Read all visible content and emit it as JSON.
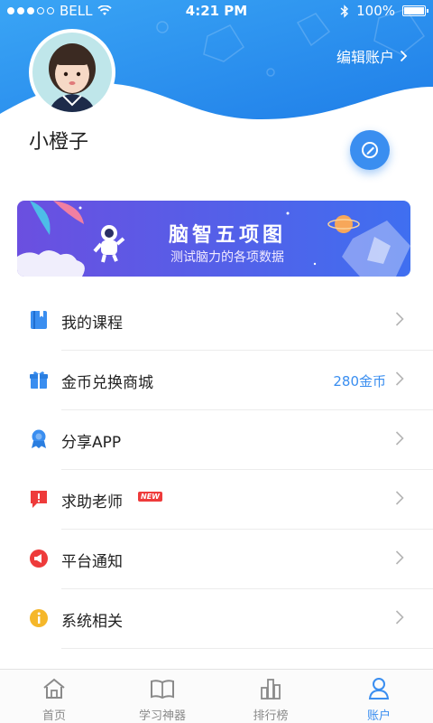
{
  "status_bar": {
    "carrier": "BELL",
    "time": "4:21 PM",
    "battery": "100%"
  },
  "profile": {
    "name": "小橙子",
    "edit_account_label": "编辑账户"
  },
  "banner": {
    "title": "脑智五项图",
    "subtitle": "测试脑力的各项数据"
  },
  "menu": {
    "items": [
      {
        "label": "我的课程",
        "icon": "book-icon",
        "color": "#3a8ef0"
      },
      {
        "label": "金币兑换商城",
        "icon": "gift-icon",
        "color": "#3a8ef0",
        "value": "280金币"
      },
      {
        "label": "分享APP",
        "icon": "share-badge-icon",
        "color": "#3a8ef0"
      },
      {
        "label": "求助老师",
        "icon": "help-chat-icon",
        "color": "#ee3b3b",
        "badge": "NEW"
      },
      {
        "label": "平台通知",
        "icon": "megaphone-icon",
        "color": "#ee3b3b"
      },
      {
        "label": "系统相关",
        "icon": "info-icon",
        "color": "#f5b72a"
      }
    ]
  },
  "tab_bar": {
    "tabs": [
      {
        "label": "首页",
        "icon": "home-icon",
        "active": false
      },
      {
        "label": "学习神器",
        "icon": "open-book-icon",
        "active": false
      },
      {
        "label": "排行榜",
        "icon": "ranking-icon",
        "active": false
      },
      {
        "label": "账户",
        "icon": "account-icon",
        "active": true
      }
    ]
  },
  "colors": {
    "accent": "#3a8ef0",
    "header_gradient_start": "#3aa5f5",
    "header_gradient_end": "#1f7ee8",
    "banner_gradient_start": "#6b4fe0",
    "banner_gradient_end": "#3f6ff0",
    "alert": "#ee3b3b",
    "warning": "#f5b72a"
  }
}
